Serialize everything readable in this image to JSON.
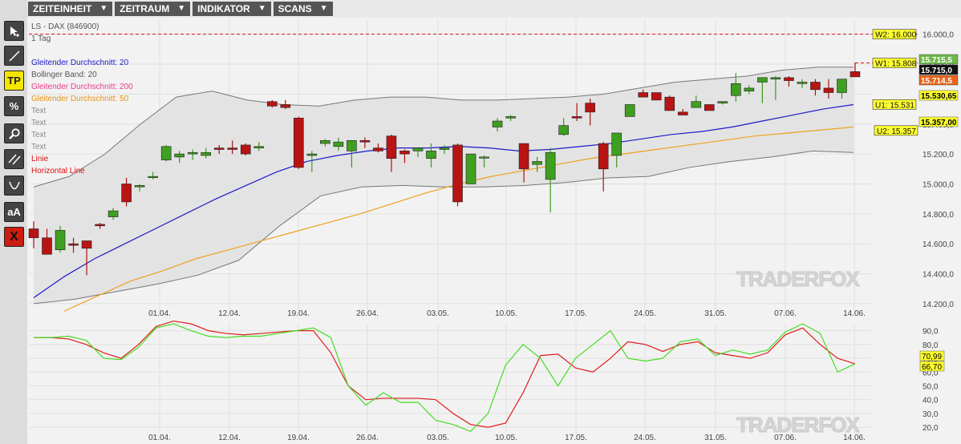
{
  "menu": [
    {
      "label": "ZEITEINHEIT"
    },
    {
      "label": "ZEITRAUM"
    },
    {
      "label": "INDIKATOR"
    },
    {
      "label": "SCANS"
    }
  ],
  "toolbar": {
    "tp_label": "TP",
    "percent_label": "%",
    "text_label": "aA",
    "delete_label": "X"
  },
  "chart_info": {
    "instrument": "LS - DAX (846900)",
    "timeframe": "1 Tag"
  },
  "legend": [
    {
      "label": "Gleitender Durchschnitt: 20",
      "color": "#1b1bc8"
    },
    {
      "label": "Bollinger Band: 20",
      "color": "#555555"
    },
    {
      "label": "Gleitender Durchschnitt: 200",
      "color": "#e83c8a"
    },
    {
      "label": "Gleitender Durchschnitt: 50",
      "color": "#e6941a"
    },
    {
      "label": "Text",
      "color": "#888888"
    },
    {
      "label": "Text",
      "color": "#888888"
    },
    {
      "label": "Text",
      "color": "#888888"
    },
    {
      "label": "Text",
      "color": "#888888"
    },
    {
      "label": "Linie",
      "color": "#dd1111"
    },
    {
      "label": "Horizontal Line",
      "color": "#dd1111"
    }
  ],
  "watermark": "TRADERFOX",
  "chart_data": [
    {
      "type": "candlestick",
      "x_ticks": [
        "01.04.",
        "12.04.",
        "19.04.",
        "26.04.",
        "03.05.",
        "10.05.",
        "17.05.",
        "24.05.",
        "31.05.",
        "07.06.",
        "14.06."
      ],
      "y_ticks": [
        "14.200,0",
        "14.400,0",
        "14.600,0",
        "14.800,0",
        "15.000,0",
        "15.200,0",
        "15.400,0",
        "15.600,0",
        "15.800,0",
        "16.000,0"
      ],
      "ylim": [
        14130,
        16100
      ],
      "candles": [
        [
          14700,
          14750,
          14570,
          14640
        ],
        [
          14640,
          14700,
          14540,
          14530
        ],
        [
          14560,
          14720,
          14540,
          14690
        ],
        [
          14600,
          14640,
          14540,
          14590
        ],
        [
          14620,
          14570,
          14390,
          14570
        ],
        [
          14730,
          14740,
          14700,
          14720
        ],
        [
          14780,
          14840,
          14760,
          14820
        ],
        [
          15000,
          15040,
          14850,
          14880
        ],
        [
          14980,
          15000,
          14950,
          14990
        ],
        [
          15050,
          15080,
          15030,
          15050
        ],
        [
          15160,
          15260,
          15150,
          15250
        ],
        [
          15180,
          15220,
          15140,
          15200
        ],
        [
          15200,
          15230,
          15160,
          15210
        ],
        [
          15190,
          15240,
          15170,
          15210
        ],
        [
          15240,
          15260,
          15200,
          15230
        ],
        [
          15240,
          15290,
          15200,
          15230
        ],
        [
          15260,
          15270,
          15190,
          15200
        ],
        [
          15240,
          15280,
          15220,
          15250
        ],
        [
          15550,
          15560,
          15510,
          15520
        ],
        [
          15530,
          15560,
          15500,
          15510
        ],
        [
          15440,
          15450,
          15100,
          15110
        ],
        [
          15190,
          15220,
          15080,
          15200
        ],
        [
          15270,
          15300,
          15250,
          15290
        ],
        [
          15250,
          15310,
          15220,
          15280
        ],
        [
          15220,
          15290,
          15110,
          15290
        ],
        [
          15290,
          15310,
          15240,
          15280
        ],
        [
          15240,
          15270,
          15210,
          15220
        ],
        [
          15320,
          15330,
          15080,
          15170
        ],
        [
          15220,
          15230,
          15140,
          15200
        ],
        [
          15220,
          15240,
          15180,
          15240
        ],
        [
          15170,
          15270,
          15110,
          15220
        ],
        [
          15230,
          15260,
          15200,
          15240
        ],
        [
          15260,
          15270,
          14850,
          14880
        ],
        [
          15000,
          15080,
          15000,
          15200
        ],
        [
          15180,
          15190,
          15110,
          15180
        ],
        [
          15380,
          15440,
          15350,
          15420
        ],
        [
          15440,
          15460,
          15420,
          15450
        ],
        [
          15270,
          15260,
          15010,
          15100
        ],
        [
          15130,
          15180,
          15080,
          15150
        ],
        [
          15030,
          15240,
          14810,
          15210
        ],
        [
          15330,
          15440,
          15320,
          15390
        ],
        [
          15450,
          15540,
          15420,
          15440
        ],
        [
          15540,
          15570,
          15390,
          15480
        ],
        [
          15270,
          15280,
          14950,
          15100
        ],
        [
          15190,
          15340,
          15110,
          15340
        ],
        [
          15450,
          15520,
          15450,
          15530
        ],
        [
          15610,
          15630,
          15580,
          15580
        ],
        [
          15610,
          15610,
          15560,
          15560
        ],
        [
          15580,
          15590,
          15500,
          15490
        ],
        [
          15480,
          15500,
          15460,
          15460
        ],
        [
          15510,
          15590,
          15510,
          15550
        ],
        [
          15530,
          15520,
          15520,
          15490
        ],
        [
          15540,
          15550,
          15530,
          15550
        ],
        [
          15590,
          15740,
          15550,
          15670
        ],
        [
          15620,
          15660,
          15600,
          15640
        ],
        [
          15680,
          15710,
          15540,
          15710
        ],
        [
          15700,
          15720,
          15560,
          15710
        ],
        [
          15710,
          15720,
          15650,
          15690
        ],
        [
          15670,
          15700,
          15640,
          15680
        ],
        [
          15680,
          15700,
          15590,
          15630
        ],
        [
          15640,
          15700,
          15570,
          15610
        ],
        [
          15610,
          15640,
          15570,
          15700
        ],
        [
          15750,
          15810,
          15720,
          15715
        ]
      ],
      "ma20_label": "Gleitender Durchschnitt: 20",
      "ma50_label": "Gleitender Durchschnitt: 50",
      "bollinger_label": "Bollinger Band: 20",
      "ma20": [
        14240,
        14380,
        14500,
        14600,
        14700,
        14800,
        14900,
        14990,
        15080,
        15150,
        15190,
        15220,
        15240,
        15240,
        15250,
        15240,
        15220,
        15230,
        15250,
        15270,
        15300,
        15330,
        15350,
        15380,
        15420,
        15460,
        15500,
        15530
      ],
      "ma50": [
        14150,
        14250,
        14350,
        14420,
        14500,
        14560,
        14620,
        14680,
        14740,
        14800,
        14870,
        14940,
        15000,
        15050,
        15090,
        15130,
        15170,
        15200,
        15230,
        15260,
        15290,
        15320,
        15340,
        15360,
        15380
      ],
      "boll_upper": [
        14980,
        15050,
        15200,
        15400,
        15580,
        15620,
        15560,
        15530,
        15520,
        15560,
        15580,
        15580,
        15560,
        15560,
        15570,
        15580,
        15600,
        15640,
        15680,
        15700,
        15720,
        15760,
        15780,
        15780
      ],
      "boll_lower": [
        14200,
        14230,
        14280,
        14330,
        14390,
        14490,
        14720,
        14920,
        14980,
        14990,
        14980,
        14980,
        14990,
        15010,
        15040,
        15050,
        15110,
        15150,
        15180,
        15220,
        15210
      ],
      "annotations": [
        {
          "label": "W2: 16.000",
          "value": 16000,
          "style": "dashed",
          "color": "#d11"
        },
        {
          "label": "W1: 15.808",
          "value": 15808,
          "style": "dashed",
          "color": "#d11"
        },
        {
          "label": "U1: 15.531",
          "value": 15531,
          "style": "none",
          "color": "#d11"
        },
        {
          "label": "U2: 15.357",
          "value": 15357,
          "style": "none",
          "color": "#d11"
        }
      ],
      "price_tags": [
        {
          "label": "15.715,5",
          "value": 15715.5,
          "bg": "#6db84a",
          "fg": "#fff"
        },
        {
          "label": "15.715,0",
          "value": 15715,
          "bg": "#111",
          "fg": "#fff"
        },
        {
          "label": "15.714,5",
          "value": 15714.5,
          "bg": "#e8641a",
          "fg": "#fff"
        },
        {
          "label": "15.530,65",
          "value": 15530.65,
          "bg": "#ffff30",
          "fg": "#000"
        },
        {
          "label": "15.357,00",
          "value": 15357,
          "bg": "#ffff30",
          "fg": "#000"
        }
      ]
    },
    {
      "type": "line",
      "title": "",
      "y_ticks": [
        "20,0",
        "30,0",
        "40,0",
        "50,0",
        "60,0",
        "70,0",
        "80,0",
        "90,0"
      ],
      "ylim": [
        16,
        95
      ],
      "series": [
        {
          "color": "#e11b1b",
          "values": [
            85,
            85,
            84,
            80,
            74,
            70,
            80,
            93,
            97,
            95,
            90,
            88,
            87,
            88,
            89,
            90,
            90,
            74,
            50,
            40,
            41,
            41,
            41,
            40,
            30,
            22,
            20,
            23,
            45,
            72,
            73,
            63,
            60,
            70,
            82,
            80,
            75,
            80,
            82,
            74,
            72,
            70,
            74,
            87,
            92,
            80,
            70,
            66
          ]
        },
        {
          "color": "#44dd22",
          "values": [
            85,
            85,
            86,
            83,
            70,
            69,
            78,
            92,
            95,
            90,
            86,
            85,
            86,
            86,
            88,
            90,
            92,
            85,
            50,
            36,
            45,
            38,
            38,
            25,
            22,
            17,
            30,
            65,
            80,
            70,
            50,
            70,
            80,
            90,
            70,
            68,
            70,
            82,
            84,
            72,
            76,
            73,
            76,
            89,
            95,
            88,
            60,
            66
          ]
        }
      ],
      "last_values": [
        {
          "label": "70,99",
          "value": 70.99,
          "bg": "#ffff30"
        },
        {
          "label": "66,70",
          "value": 66.7,
          "bg": "#ffff30"
        }
      ]
    }
  ]
}
